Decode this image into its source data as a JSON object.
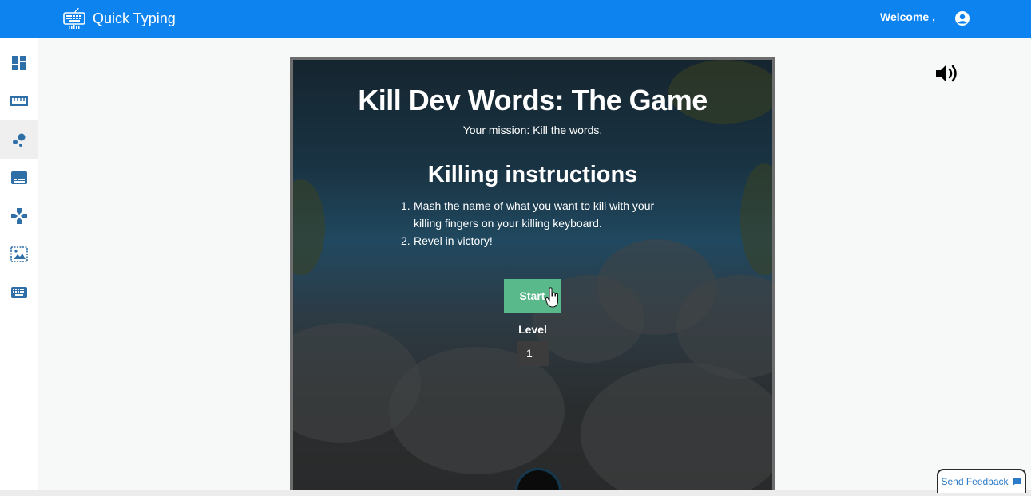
{
  "app": {
    "title": "Quick Typing",
    "brand_color": "#0d83f0",
    "welcome_text": "Welcome ,"
  },
  "sidebar": {
    "items": [
      {
        "icon": "dashboard-icon",
        "active": false
      },
      {
        "icon": "ruler-icon",
        "active": false
      },
      {
        "icon": "dots-icon",
        "active": true
      },
      {
        "icon": "subtitles-icon",
        "active": false
      },
      {
        "icon": "gamepad-icon",
        "active": false
      },
      {
        "icon": "image-frame-icon",
        "active": false
      },
      {
        "icon": "keyboard-icon",
        "active": false
      }
    ],
    "icon_color": "#2f6fa8"
  },
  "game": {
    "title": "Kill Dev Words: The Game",
    "subtitle": "Your mission: Kill the words.",
    "instructions_heading": "Killing instructions",
    "instructions": [
      {
        "num": "1.",
        "text": "Mash the name of what you want to kill with your killing fingers on your killing keyboard."
      },
      {
        "num": "2.",
        "text": "Revel in victory!"
      }
    ],
    "start_label": "Start",
    "start_color": "#5ab98a",
    "level_label": "Level",
    "level_value": "1"
  },
  "feedback": {
    "label": "Send Feedback",
    "icon": "chat-icon"
  }
}
